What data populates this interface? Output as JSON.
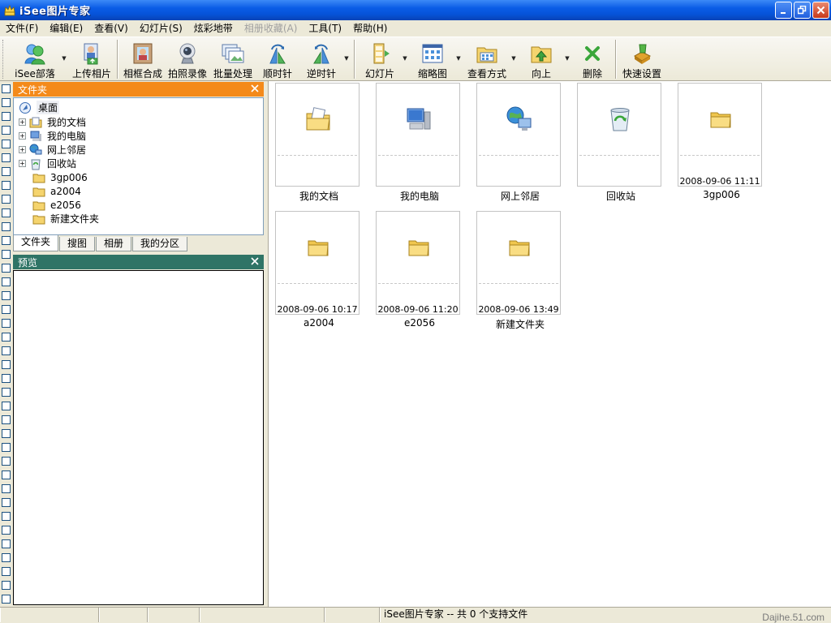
{
  "window": {
    "title": "iSee图片专家"
  },
  "menu": [
    "文件(F)",
    "编辑(E)",
    "查看(V)",
    "幻灯片(S)",
    "炫彩地带",
    "相册收藏(A)",
    "工具(T)",
    "帮助(H)"
  ],
  "toolbar": {
    "buttons": [
      {
        "label": "iSee部落",
        "icon": "users-icon"
      },
      {
        "label": "上传相片",
        "icon": "upload-photo-icon"
      },
      {
        "label": "相框合成",
        "icon": "photo-frame-icon"
      },
      {
        "label": "拍照录像",
        "icon": "webcam-icon"
      },
      {
        "label": "批量处理",
        "icon": "batch-icon"
      },
      {
        "label": "顺时针",
        "icon": "rotate-cw-icon"
      },
      {
        "label": "逆时针",
        "icon": "rotate-ccw-icon"
      },
      {
        "label": "幻灯片",
        "icon": "slideshow-icon"
      },
      {
        "label": "缩略图",
        "icon": "thumbnails-icon"
      },
      {
        "label": "查看方式",
        "icon": "view-mode-icon"
      },
      {
        "label": "向上",
        "icon": "folder-up-icon"
      },
      {
        "label": "删除",
        "icon": "delete-icon"
      },
      {
        "label": "快速设置",
        "icon": "quick-settings-icon"
      }
    ]
  },
  "folder_panel": {
    "title": "文件夹",
    "root": "桌面",
    "items": [
      "我的文档",
      "我的电脑",
      "网上邻居",
      "回收站",
      "3gp006",
      "a2004",
      "e2056",
      "新建文件夹"
    ]
  },
  "tabs": [
    "文件夹",
    "搜图",
    "相册",
    "我的分区"
  ],
  "preview_panel": {
    "title": "预览"
  },
  "thumbnails": [
    {
      "name": "我的文档",
      "date": "",
      "icon": "my-documents-icon"
    },
    {
      "name": "我的电脑",
      "date": "",
      "icon": "my-computer-icon"
    },
    {
      "name": "网上邻居",
      "date": "",
      "icon": "network-icon"
    },
    {
      "name": "回收站",
      "date": "",
      "icon": "recycle-bin-icon"
    },
    {
      "name": "3gp006",
      "date": "2008-09-06 11:11",
      "icon": "folder-icon"
    },
    {
      "name": "a2004",
      "date": "2008-09-06 10:17",
      "icon": "folder-icon"
    },
    {
      "name": "e2056",
      "date": "2008-09-06 11:20",
      "icon": "folder-icon"
    },
    {
      "name": "新建文件夹",
      "date": "2008-09-06 13:49",
      "icon": "folder-icon"
    }
  ],
  "status": {
    "text": "iSee图片专家 -- 共 0 个支持文件"
  },
  "watermark": "Dajihe.51.com"
}
